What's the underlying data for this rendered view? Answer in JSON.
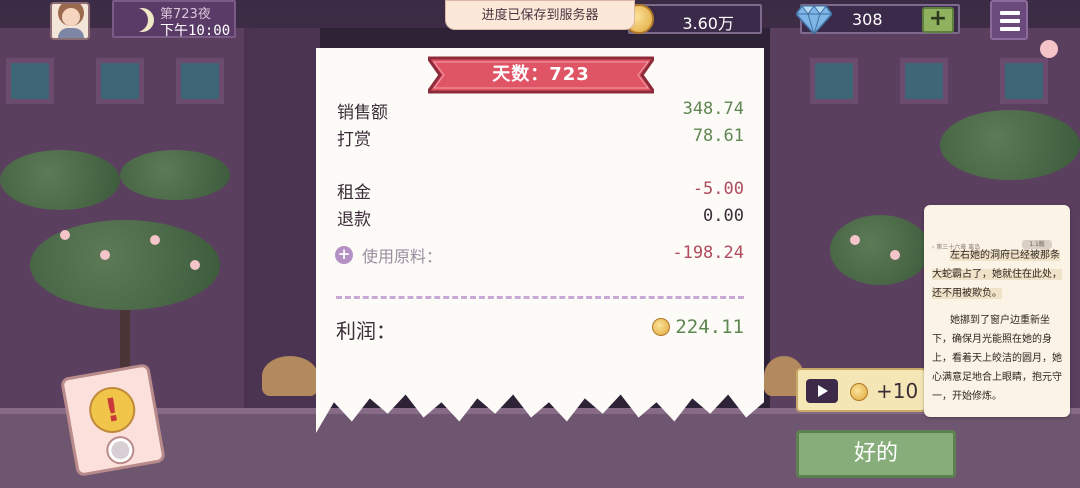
{
  "hud": {
    "day_label": "第723夜",
    "time_label": "下午10:00",
    "save_toast": "进度已保存到服务器",
    "coins": "3.60万",
    "gems": "308",
    "add_gems_symbol": "+"
  },
  "receipt": {
    "day_title": "天数：723",
    "rows": [
      {
        "label": "销售额",
        "value": "348.74"
      },
      {
        "label": "打赏",
        "value": "78.61"
      },
      {
        "label": "租金",
        "value": "-5.00"
      },
      {
        "label": "退款",
        "value": "0.00"
      }
    ],
    "ingredients_label": "使用原料：",
    "ingredients_value": "-198.24",
    "profit_label": "利润：",
    "profit_value": "224.11"
  },
  "reward": {
    "amount": "+10"
  },
  "ok_label": "好的",
  "alert_symbol": "!",
  "novel": {
    "header": "‹ 第三十六章 离岛",
    "chip": "1.1版",
    "paragraph1_hl": "左右她的洞府已经被那条大蛇霸占了，她就住在此处，还不用被欺负。",
    "paragraph2": "她挪到了窗户边重新坐下，确保月光能照在她的身上，看着天上皎洁的圆月，她心满意足地合上眼睛，抱元守一，开始修炼。"
  },
  "colors": {
    "ribbon": "#e05566",
    "profit_green": "#5f8752",
    "negative_red": "#b04c5c",
    "ok_button": "#87ae7a"
  }
}
